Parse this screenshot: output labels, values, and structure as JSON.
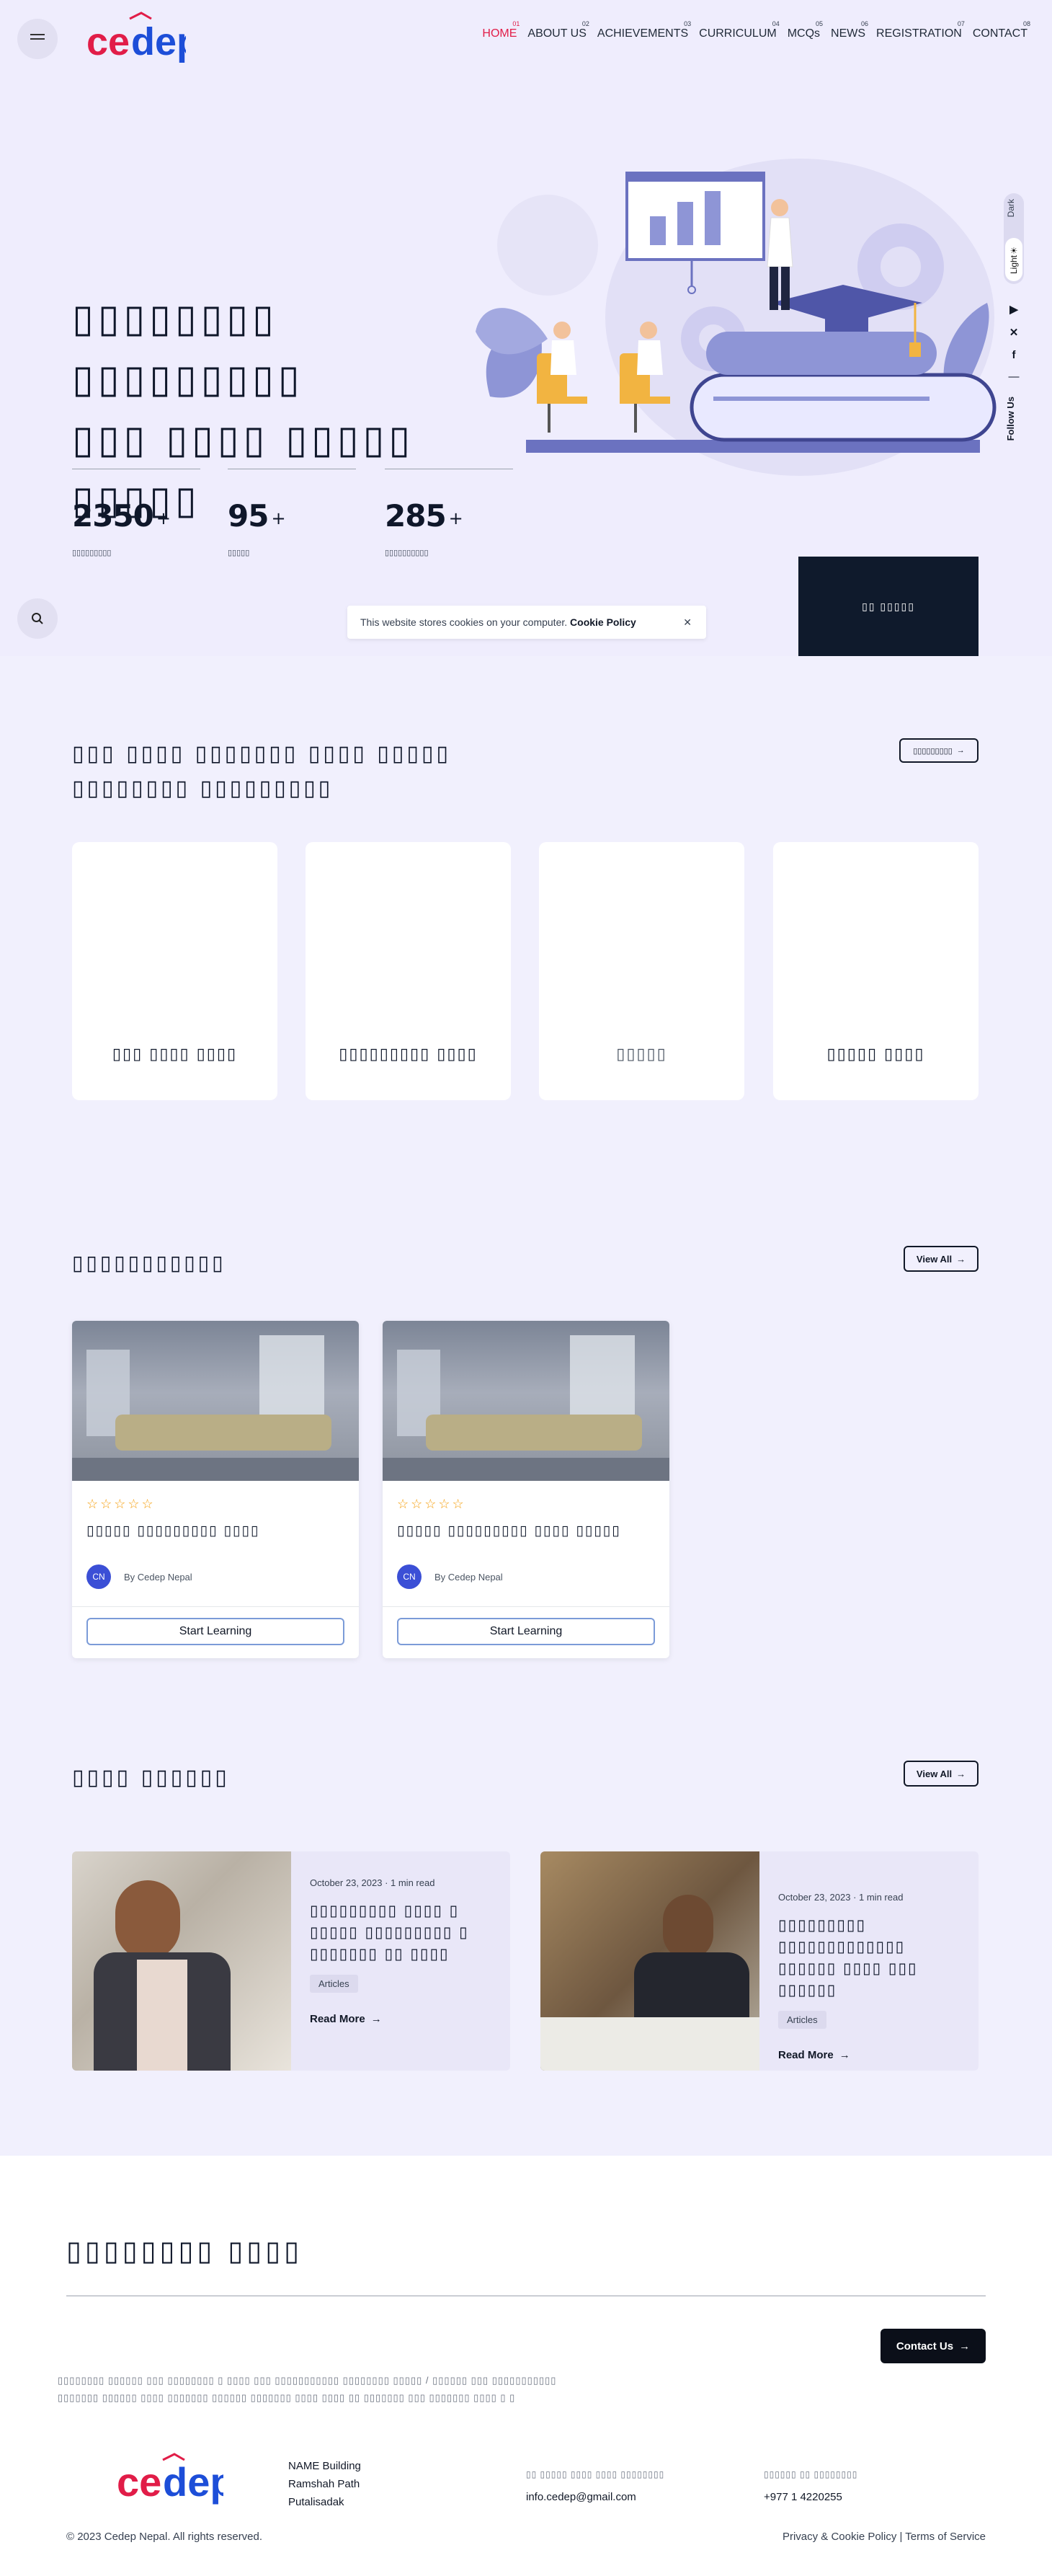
{
  "header": {
    "logo_text": "cedep",
    "nav": [
      {
        "num": "01",
        "label": "HOME",
        "active": true
      },
      {
        "num": "02",
        "label": "ABOUT US"
      },
      {
        "num": "03",
        "label": "ACHIEVEMENTS"
      },
      {
        "num": "04",
        "label": "CURRICULUM"
      },
      {
        "num": "05",
        "label": "MCQs"
      },
      {
        "num": "06",
        "label": "NEWS"
      },
      {
        "num": "07",
        "label": "REGISTRATION"
      },
      {
        "num": "08",
        "label": "CONTACT"
      }
    ]
  },
  "hero": {
    "title_line1": "▯▯▯▯▯▯▯▯ ▯▯▯▯▯▯▯▯▯",
    "title_line2": "▯▯▯ ▯▯▯▯ ▯▯▯▯▯ ▯▯▯▯▯",
    "stats": [
      {
        "value": "2350",
        "suffix": "+",
        "label": "▯▯▯▯▯▯▯▯▯"
      },
      {
        "value": "95",
        "suffix": "+",
        "label": "▯▯▯▯▯"
      },
      {
        "value": "285",
        "suffix": "+",
        "label": "▯▯▯▯▯▯▯▯▯▯"
      }
    ],
    "dark_box_text": "▯▯ ▯▯▯▯▯",
    "theme_dark": "Dark",
    "theme_light": "Light",
    "follow_us": "Follow Us"
  },
  "cookie": {
    "text": "This website stores cookies on your computer.",
    "link": "Cookie Policy",
    "close": "✕"
  },
  "courses": {
    "title_line1": "▯▯▯ ▯▯▯▯ ▯▯▯▯▯▯▯ ▯▯▯▯ ▯▯▯▯▯",
    "title_line2": "▯▯▯▯▯▯▯▯ ▯▯▯▯▯▯▯▯▯",
    "button": "▯▯▯▯▯▯▯▯▯",
    "cards": [
      {
        "title": "▯▯▯ ▯▯▯▯ ▯▯▯▯"
      },
      {
        "title": "▯▯▯▯▯▯▯▯▯ ▯▯▯▯"
      },
      {
        "title": "▯▯▯▯▯"
      },
      {
        "title": "▯▯▯▯▯ ▯▯▯▯"
      }
    ]
  },
  "mcqs": {
    "title": "▯▯▯▯▯▯▯▯▯▯▯",
    "view_all": "View All",
    "cards": [
      {
        "stars": "☆☆☆☆☆",
        "title": "▯▯▯▯▯ ▯▯▯▯▯▯▯▯▯ ▯▯▯▯",
        "avatar": "CN",
        "author": "By Cedep Nepal",
        "button": "Start Learning"
      },
      {
        "stars": "☆☆☆☆☆",
        "title": "▯▯▯▯▯ ▯▯▯▯▯▯▯▯▯ ▯▯▯▯ ▯▯▯▯▯",
        "avatar": "CN",
        "author": "By Cedep Nepal",
        "button": "Start Learning"
      }
    ]
  },
  "news": {
    "title": "▯▯▯▯ ▯▯▯▯▯▯",
    "view_all": "View All",
    "articles": [
      {
        "date": "October 23, 2023 · 1 min read",
        "title": "▯▯▯▯▯▯▯▯▯ ▯▯▯▯ ▯ ▯▯▯▯▯ ▯▯▯▯▯▯▯▯▯ ▯ ▯▯▯▯▯▯▯ ▯▯ ▯▯▯▯",
        "tag": "Articles",
        "read_more": "Read More"
      },
      {
        "date": "October 23, 2023 · 1 min read",
        "title": "▯▯▯▯▯▯▯▯▯ ▯▯▯▯▯▯▯▯▯▯▯▯▯ ▯▯▯▯▯▯ ▯▯▯▯ ▯▯▯ ▯▯▯▯▯▯",
        "tag": "Articles",
        "read_more": "Read More"
      }
    ]
  },
  "footer": {
    "title": "▯▯▯▯▯▯▯▯ ▯▯▯▯",
    "contact_button": "Contact Us",
    "desc_line1": "▯▯▯▯▯▯▯▯ ▯▯▯▯▯▯ ▯▯▯ ▯▯▯▯▯▯▯▯ ▯ ▯▯▯▯ ▯▯▯ ▯▯▯▯▯▯▯▯▯▯▯ ▯▯▯▯▯▯▯▯ ▯▯▯▯▯ / ▯▯▯▯▯▯ ▯▯▯ ▯▯▯▯▯▯▯▯▯▯▯",
    "desc_line2": "▯▯▯▯▯▯▯ ▯▯▯▯▯▯ ▯▯▯▯ ▯▯▯▯▯▯▯ ▯▯▯▯▯▯ ▯▯▯▯▯▯▯ ▯▯▯▯ ▯▯▯▯ ▯▯ ▯▯▯▯▯▯▯ ▯▯▯ ▯▯▯▯▯▯▯ ▯▯▯▯ ▯ ▯",
    "address": [
      "NAME Building",
      "Ramshah Path",
      "Putalisadak"
    ],
    "email_label": "▯▯ ▯▯▯▯▯ ▯▯▯▯ ▯▯▯▯ ▯▯▯▯▯▯▯▯",
    "email": "info.cedep@gmail.com",
    "phone_label": "▯▯▯▯▯▯ ▯▯ ▯▯▯▯▯▯▯▯",
    "phone": "+977 1 4220255",
    "copyright": "© 2023 Cedep Nepal. All rights reserved.",
    "legal": "Privacy & Cookie Policy | Terms of Service"
  },
  "colors": {
    "accent": "#e11d48",
    "brand_blue": "#1d4ed8",
    "hero_bg": "#efedfd",
    "dark": "#0f1a2c"
  }
}
